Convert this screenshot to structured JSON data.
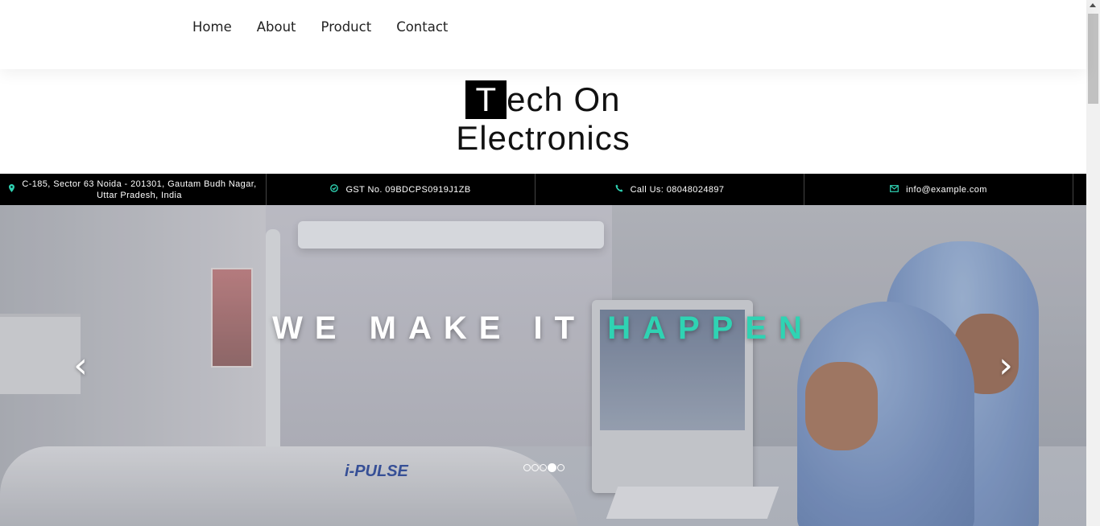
{
  "nav": {
    "items": [
      {
        "label": "Home"
      },
      {
        "label": "About"
      },
      {
        "label": "Product"
      },
      {
        "label": "Contact"
      }
    ]
  },
  "brand": {
    "first_letter": "T",
    "line1_rest": "ech On",
    "line2": "Electronics"
  },
  "infobar": {
    "address_line1": "C-185, Sector 63 Noida - 201301, Gautam Budh Nagar,",
    "address_line2": "Uttar Pradesh, India",
    "gst": "GST No. 09BDCPS0919J1ZB",
    "phone": "Call Us: 08048024897",
    "email": "info@example.com",
    "icons": [
      "map-marker-icon",
      "check-circle-icon",
      "phone-icon",
      "envelope-icon"
    ],
    "accent_color": "#2fd3b3"
  },
  "hero": {
    "title_plain": "WE MAKE IT ",
    "title_accent": "HAPPEN",
    "prev_label": "‹",
    "next_label": "›",
    "slide_count": 5,
    "active_slide": 4,
    "machine_label": "i-PULSE"
  },
  "colors": {
    "accent": "#2fd3b3",
    "infobar_bg": "#000000"
  }
}
